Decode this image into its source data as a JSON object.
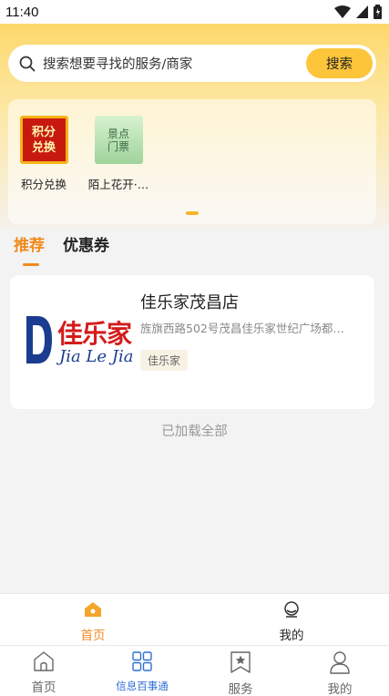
{
  "status_bar": {
    "time": "11:40"
  },
  "search": {
    "placeholder": "搜索想要寻找的服务/商家",
    "button_label": "搜索"
  },
  "categories": [
    {
      "label": "积分兑换",
      "thumb_text": "积分兑换",
      "icon": "points-exchange-icon"
    },
    {
      "label": "陌上花开·…",
      "thumb_text": "景点门票",
      "icon": "scenic-ticket-icon"
    }
  ],
  "tabs": [
    {
      "label": "推荐",
      "active": true
    },
    {
      "label": "优惠券",
      "active": false
    }
  ],
  "merchant": {
    "name": "佳乐家茂昌店",
    "address": "旌旗西路502号茂昌佳乐家世纪广场都…",
    "tag": "佳乐家",
    "logo_text_cn": "佳乐家",
    "logo_text_en": "Jia Le Jia"
  },
  "list_end_text": "已加载全部",
  "bottom_nav_primary": [
    {
      "label": "首页",
      "icon": "home-icon",
      "active": true
    },
    {
      "label": "我的",
      "icon": "profile-icon",
      "active": false
    }
  ],
  "bottom_nav_secondary": [
    {
      "label": "首页",
      "icon": "home-outline-icon"
    },
    {
      "label": "信息百事通",
      "icon": "grid-icon",
      "active": true
    },
    {
      "label": "服务",
      "icon": "service-star-icon"
    },
    {
      "label": "我的",
      "icon": "user-icon"
    }
  ],
  "colors": {
    "accent_orange": "#f08a1c",
    "search_button": "#fcc53a",
    "secondary_active": "#2f6fd6"
  }
}
